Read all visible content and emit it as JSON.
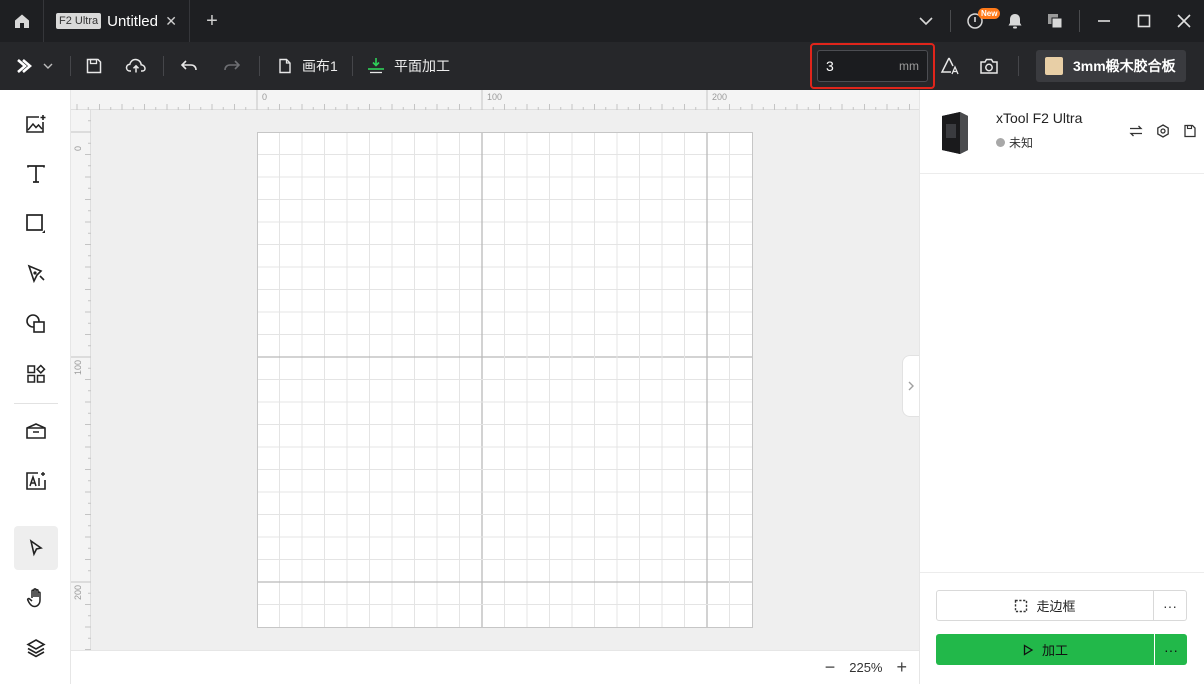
{
  "titlebar": {
    "tab_badge": "F2 Ultra",
    "tab_title": "Untitled",
    "tab_close": "✕",
    "new_tab": "+",
    "new_badge": "New"
  },
  "toolbar": {
    "canvas_label": "画布1",
    "process_mode": "平面加工",
    "thickness_value": "3",
    "thickness_unit": "mm",
    "material_label": "3mm椴木胶合板",
    "material_color": "#e8cfa6"
  },
  "rulers": {
    "top_labels": [
      "0",
      "100",
      "200"
    ],
    "left_labels": [
      "0",
      "100",
      "200"
    ]
  },
  "status": {
    "zoom_level": "225%",
    "zoom_out": "−",
    "zoom_in": "+"
  },
  "device": {
    "name": "xTool F2 Ultra",
    "status": "未知"
  },
  "actions": {
    "frame_label": "走边框",
    "process_label": "加工",
    "more": "···"
  },
  "colors": {
    "accent_green": "#22b84a",
    "highlight_red": "#e0251b"
  }
}
